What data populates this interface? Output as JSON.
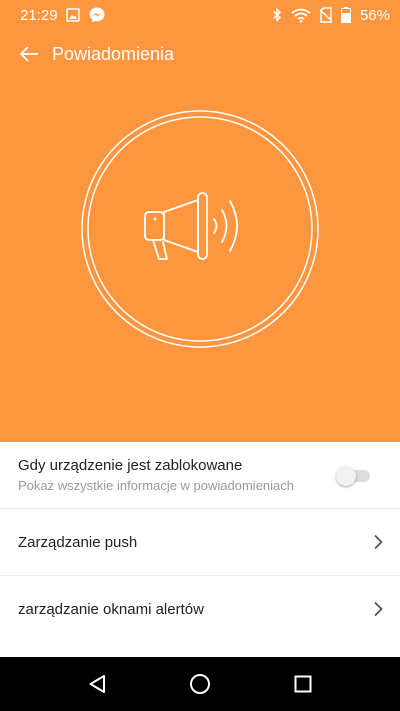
{
  "colors": {
    "accent": "#fe953f",
    "nav_bar": "#000000",
    "title_text": "#222222",
    "subtitle_text": "#9a9a9a"
  },
  "status_bar": {
    "time": "21:29",
    "battery_percent": "56%",
    "icons_left": [
      "image-icon",
      "messenger-icon"
    ],
    "icons_right": [
      "bluetooth-icon",
      "wifi-icon",
      "no-sim-icon",
      "battery-icon"
    ]
  },
  "app_bar": {
    "title": "Powiadomienia",
    "back_icon": "arrow-left-icon"
  },
  "hero": {
    "icon": "megaphone-icon"
  },
  "settings": {
    "lock_screen": {
      "title": "Gdy urządzenie jest zablokowane",
      "subtitle": "Pokaż wszystkie informacje w powiadomieniach",
      "enabled": false
    },
    "push": {
      "title": "Zarządzanie push"
    },
    "alerts": {
      "title": "zarządzanie oknami alertów"
    }
  },
  "nav_bar": {
    "buttons": [
      "back-triangle-icon",
      "home-circle-icon",
      "recents-square-icon"
    ]
  }
}
